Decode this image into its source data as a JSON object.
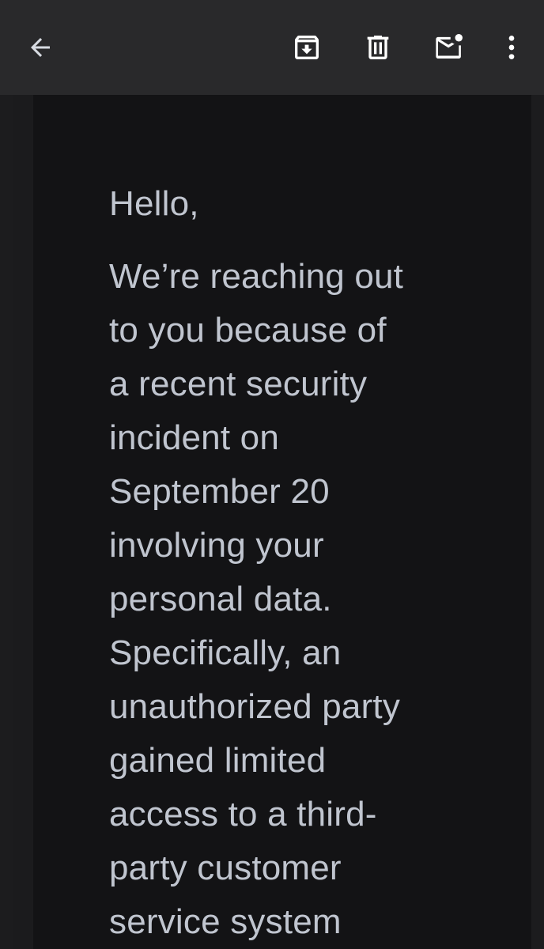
{
  "toolbar": {
    "back_icon": "arrow-back-icon",
    "archive_icon": "archive-icon",
    "delete_icon": "trash-icon",
    "unread_icon": "mark-unread-icon",
    "more_icon": "more-vert-icon"
  },
  "colors": {
    "toolbar_bg": "#29292b",
    "body_bg": "#131315",
    "text": "#c0c5cf",
    "icon": "#ffffff"
  },
  "email": {
    "greeting": "Hello,",
    "paragraph_lines": [
      "We’re reaching out",
      "to you because of",
      "a recent security",
      "incident on",
      "September 20",
      "involving your",
      "personal data.",
      "Specifically, an",
      "unauthorized party",
      "gained limited",
      "access to a third-",
      "party customer",
      "service system"
    ]
  }
}
